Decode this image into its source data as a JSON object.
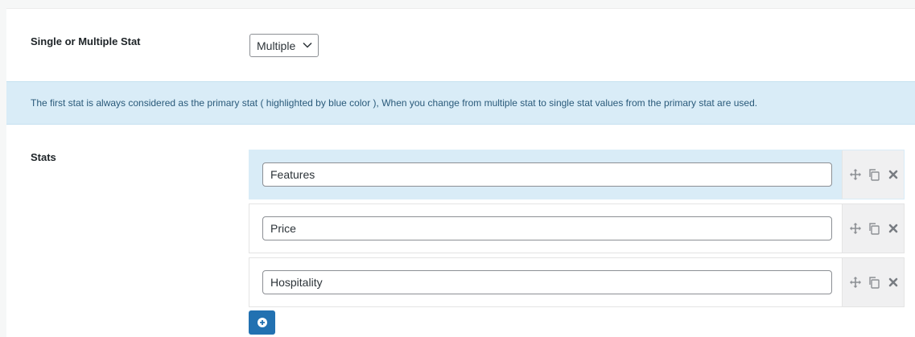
{
  "mode_field": {
    "label": "Single or Multiple Stat",
    "selected": "Multiple",
    "icon": "chevron-down-icon"
  },
  "notice": {
    "text": "The first stat is always considered as the primary stat ( highlighted by blue color ), When you change from multiple stat to single stat values from the primary stat are used."
  },
  "stats": {
    "label": "Stats",
    "items": [
      {
        "value": "Features",
        "primary": true
      },
      {
        "value": "Price",
        "primary": false
      },
      {
        "value": "Hospitality",
        "primary": false
      }
    ],
    "row_icons": [
      "move-icon",
      "copy-icon",
      "delete-icon"
    ],
    "add_icon": "plus-circle-icon"
  },
  "colors": {
    "primary_highlight": "#d9ecf7",
    "button": "#2271b1"
  }
}
